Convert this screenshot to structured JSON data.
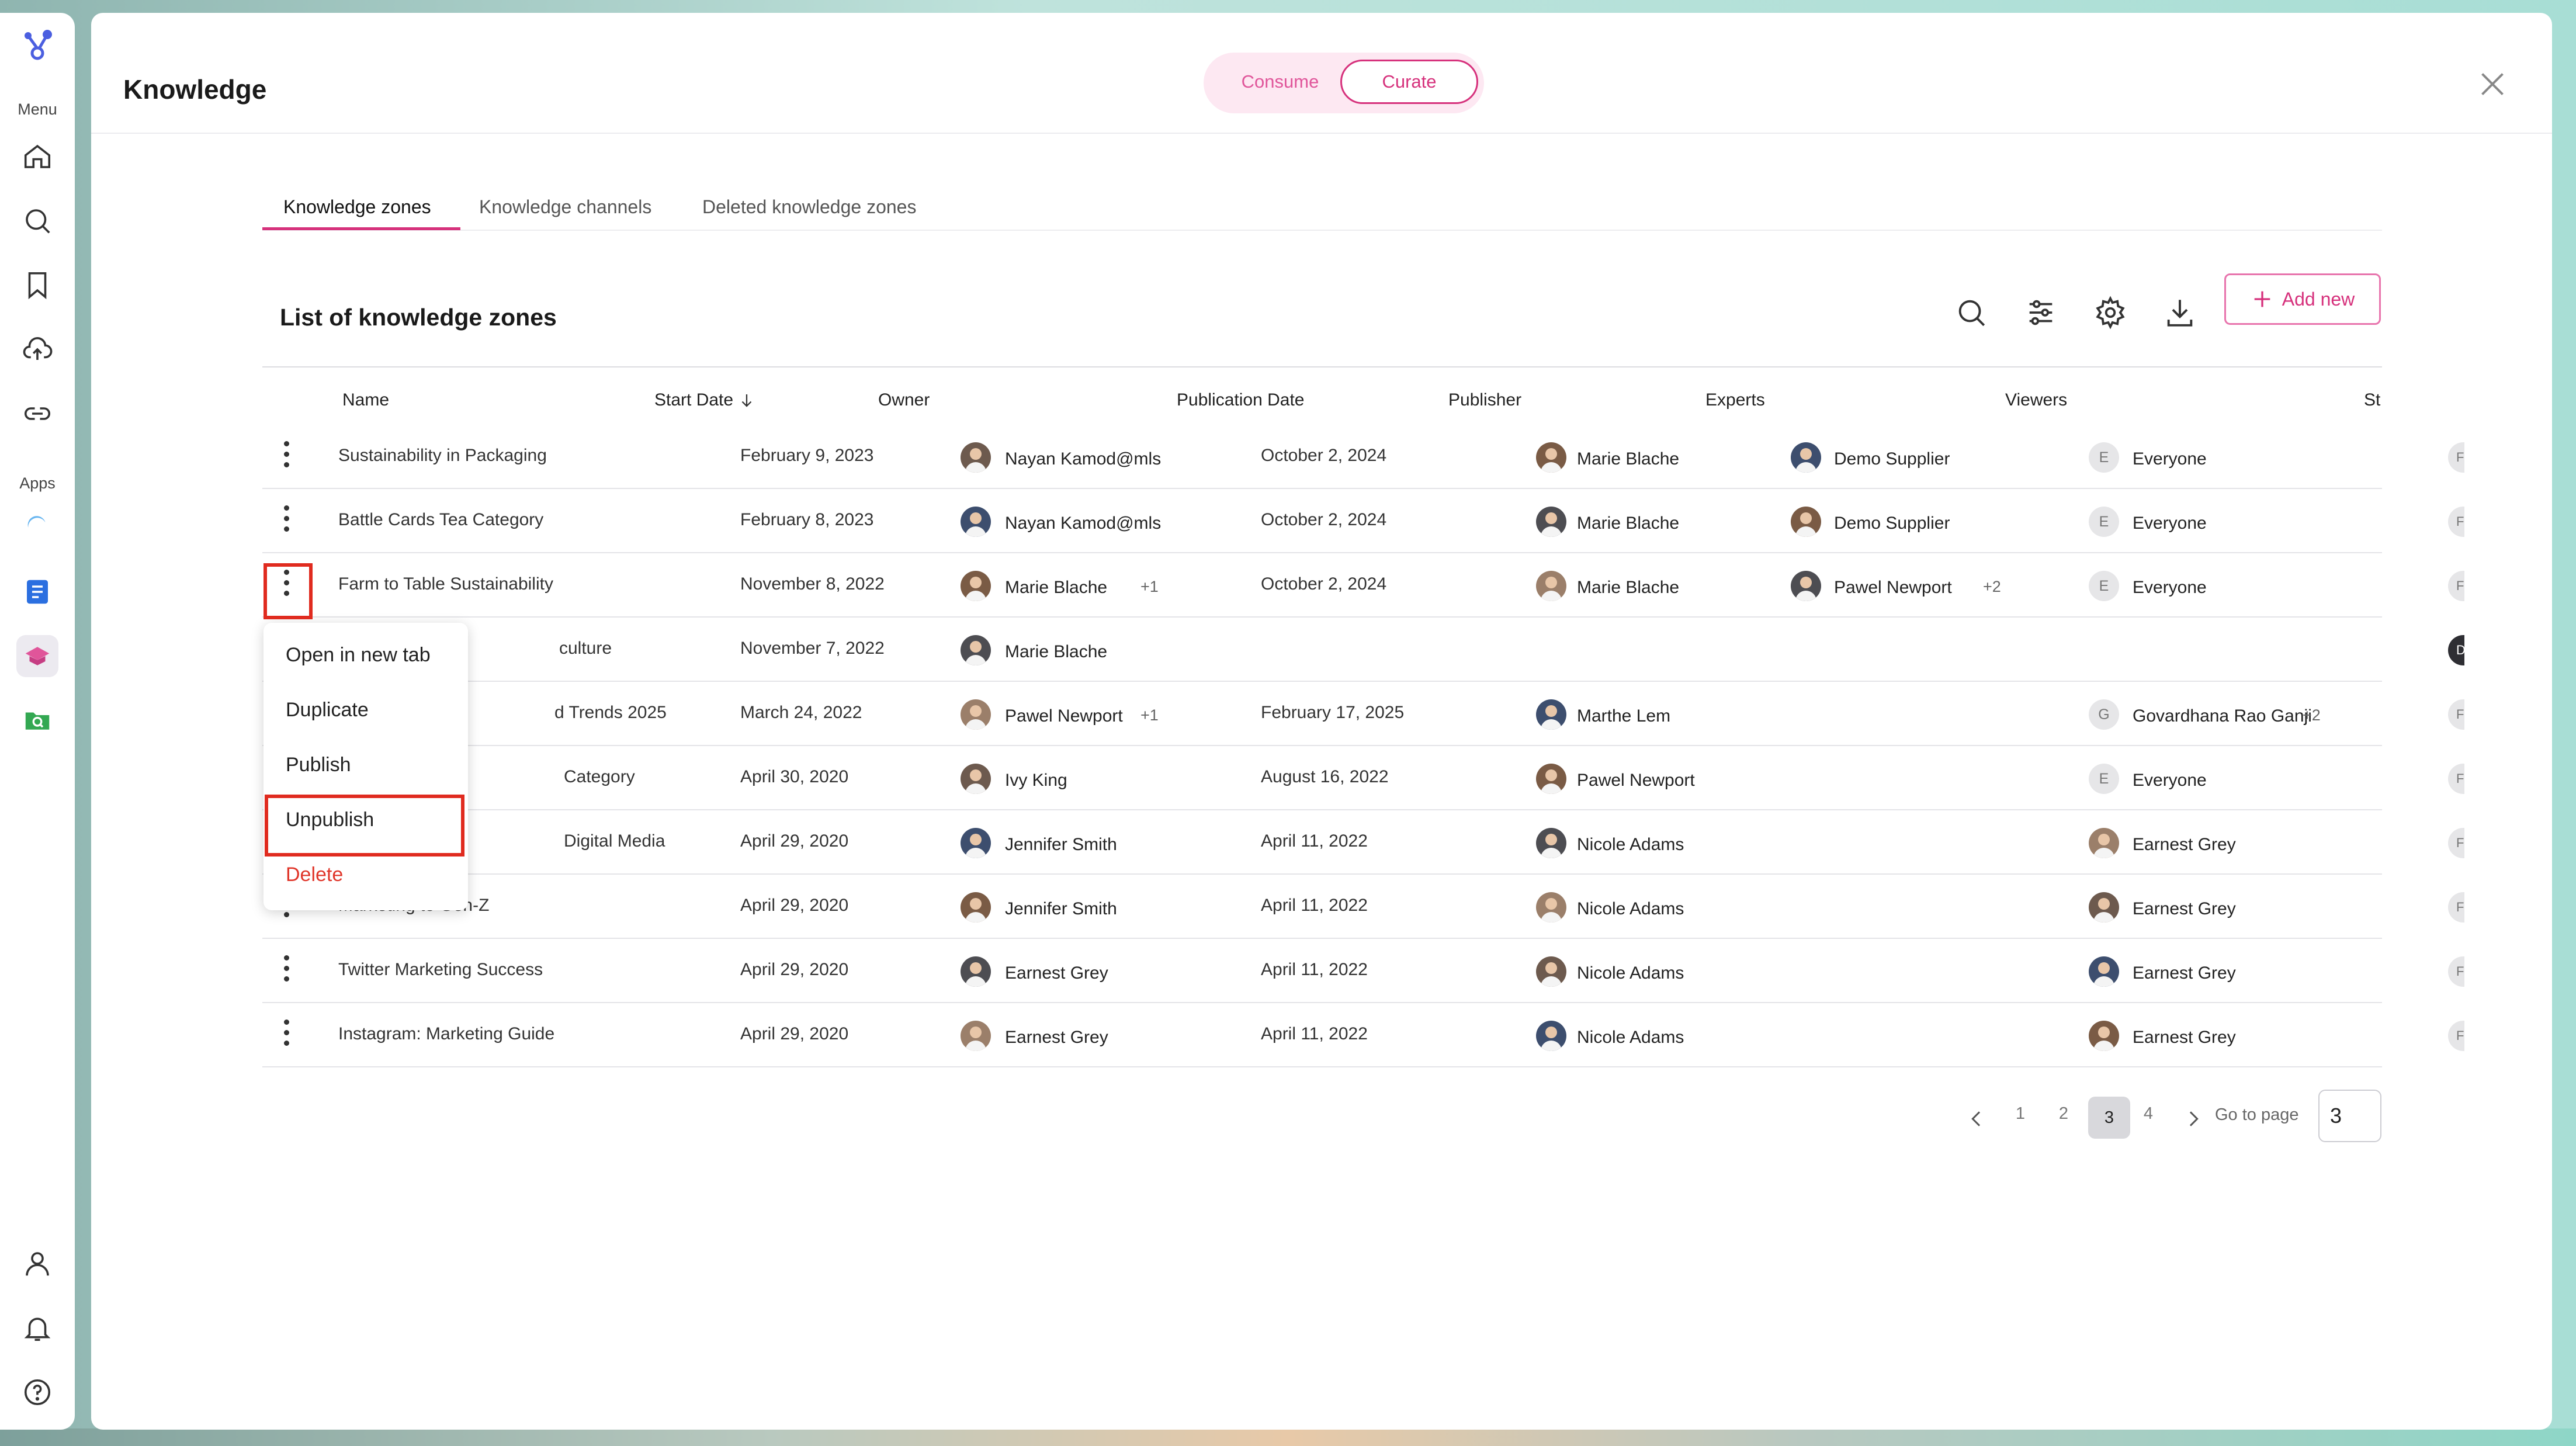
{
  "sidebar": {
    "menu_label": "Menu",
    "apps_label": "Apps"
  },
  "header": {
    "title": "Knowledge",
    "toggle": {
      "consume": "Consume",
      "curate": "Curate",
      "selected": "Curate"
    }
  },
  "tabs": [
    {
      "label": "Knowledge zones",
      "active": true
    },
    {
      "label": "Knowledge channels",
      "active": false
    },
    {
      "label": "Deleted knowledge zones",
      "active": false
    }
  ],
  "list": {
    "title": "List of knowledge zones",
    "add_label": "Add new"
  },
  "table": {
    "headers": [
      "Name",
      "Start Date",
      "Owner",
      "Publication Date",
      "Publisher",
      "Experts",
      "Viewers",
      "St"
    ],
    "rows": [
      {
        "name": "Sustainability in Packaging",
        "start": "February 9, 2023",
        "owner": "Nayan Kamod@mls",
        "owner_extra": "",
        "pub_date": "October 2, 2024",
        "publisher": "Marie Blache",
        "experts": "Demo Supplier",
        "experts_extra": "",
        "viewers": "Everyone",
        "viewers_letter": "E",
        "viewers_extra": "",
        "status": "F"
      },
      {
        "name": "Battle Cards Tea Category",
        "start": "February 8, 2023",
        "owner": "Nayan Kamod@mls",
        "owner_extra": "",
        "pub_date": "October 2, 2024",
        "publisher": "Marie Blache",
        "experts": "Demo Supplier",
        "experts_extra": "",
        "viewers": "Everyone",
        "viewers_letter": "E",
        "viewers_extra": "",
        "status": "F"
      },
      {
        "name": "Farm to Table Sustainability",
        "start": "November 8, 2022",
        "owner": "Marie Blache",
        "owner_extra": "+1",
        "pub_date": "October 2, 2024",
        "publisher": "Marie Blache",
        "experts": "Pawel Newport",
        "experts_extra": "+2",
        "viewers": "Everyone",
        "viewers_letter": "E",
        "viewers_extra": "",
        "status": "F"
      },
      {
        "name": "culture",
        "start": "November 7, 2022",
        "owner": "Marie Blache",
        "owner_extra": "",
        "pub_date": "",
        "publisher": "",
        "experts": "",
        "experts_extra": "",
        "viewers": "",
        "viewers_letter": "",
        "viewers_extra": "",
        "status": "D"
      },
      {
        "name": "d Trends 2025",
        "start": "March 24, 2022",
        "owner": "Pawel Newport",
        "owner_extra": "+1",
        "pub_date": "February 17, 2025",
        "publisher": "Marthe Lem",
        "experts": "",
        "experts_extra": "",
        "viewers": "Govardhana Rao Ganji",
        "viewers_letter": "G",
        "viewers_extra": "+2",
        "status": "F"
      },
      {
        "name": "Category",
        "start": "April 30, 2020",
        "owner": "Ivy King",
        "owner_extra": "",
        "pub_date": "August 16, 2022",
        "publisher": "Pawel Newport",
        "experts": "",
        "experts_extra": "",
        "viewers": "Everyone",
        "viewers_letter": "E",
        "viewers_extra": "",
        "status": "F"
      },
      {
        "name": "Digital Media",
        "start": "April 29, 2020",
        "owner": "Jennifer Smith",
        "owner_extra": "",
        "pub_date": "April 11, 2022",
        "publisher": "Nicole Adams",
        "experts": "",
        "experts_extra": "",
        "viewers": "Earnest Grey",
        "viewers_letter": "",
        "viewers_extra": "",
        "status": "F"
      },
      {
        "name": "Marketing to Gen-Z",
        "start": "April 29, 2020",
        "owner": "Jennifer Smith",
        "owner_extra": "",
        "pub_date": "April 11, 2022",
        "publisher": "Nicole Adams",
        "experts": "",
        "experts_extra": "",
        "viewers": "Earnest Grey",
        "viewers_letter": "",
        "viewers_extra": "",
        "status": "F"
      },
      {
        "name": "Twitter Marketing Success",
        "start": "April 29, 2020",
        "owner": "Earnest Grey",
        "owner_extra": "",
        "pub_date": "April 11, 2022",
        "publisher": "Nicole Adams",
        "experts": "",
        "experts_extra": "",
        "viewers": "Earnest Grey",
        "viewers_letter": "",
        "viewers_extra": "",
        "status": "F"
      },
      {
        "name": "Instagram: Marketing Guide",
        "start": "April 29, 2020",
        "owner": "Earnest Grey",
        "owner_extra": "",
        "pub_date": "April 11, 2022",
        "publisher": "Nicole Adams",
        "experts": "",
        "experts_extra": "",
        "viewers": "Earnest Grey",
        "viewers_letter": "",
        "viewers_extra": "",
        "status": "F"
      }
    ]
  },
  "context_menu": {
    "items": [
      "Open in new tab",
      "Duplicate",
      "Publish",
      "Unpublish",
      "Delete"
    ]
  },
  "pagination": {
    "pages": [
      "1",
      "2",
      "3",
      "4"
    ],
    "current": "3",
    "goto_label": "Go to page",
    "goto_value": "3"
  },
  "colors": {
    "accent": "#d6317c",
    "highlight_box": "#e02b1f",
    "delete": "#e0362a"
  }
}
